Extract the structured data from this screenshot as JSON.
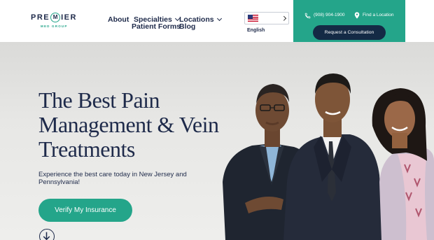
{
  "brand": {
    "name_before": "PRE",
    "name_badge": "M",
    "name_after": "IER",
    "tagline": "MED GROUP"
  },
  "nav": {
    "about": "About",
    "specialties": "Specialties",
    "locations": "Locations",
    "patient_forms": "Patient Forms",
    "blog": "Blog"
  },
  "language": {
    "selected": "English",
    "flag_icon": "us-flag-icon"
  },
  "contact": {
    "phone": "(908) 904-1900",
    "find_location": "Find a Location",
    "consult_button": "Request a Consultation"
  },
  "hero": {
    "title": "The Best Pain Management & Vein Treatments",
    "subtitle": "Experience the best care today in New Jersey and Pennsylvania!",
    "cta": "Verify My Insurance"
  },
  "colors": {
    "brand_teal": "#24a58a",
    "navy": "#1e2a4a",
    "dark_button": "#142a45",
    "hero_bg": "#e4e4e2"
  }
}
